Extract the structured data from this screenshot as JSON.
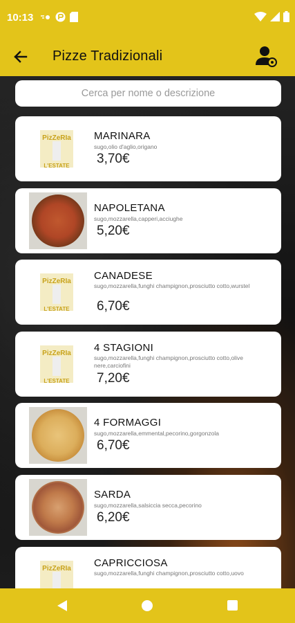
{
  "status": {
    "time": "10:13"
  },
  "header": {
    "title": "Pizze Tradizionali"
  },
  "search": {
    "placeholder": "Cerca per nome o descrizione"
  },
  "items": [
    {
      "name": "MARINARA",
      "desc": "sugo,olio d'aglio,origano",
      "price": "3,70€",
      "image": "logo"
    },
    {
      "name": "NAPOLETANA",
      "desc": "sugo,mozzarella,capperi,acciughe",
      "price": "5,20€",
      "image": "pizza"
    },
    {
      "name": "CANADESE",
      "desc": "sugo,mozzarella,funghi champignon,prosciutto cotto,wurstel",
      "price": "6,70€",
      "image": "logo"
    },
    {
      "name": "4 STAGIONI",
      "desc": "sugo,mozzarella,funghi champignon,prosciutto cotto,olive nere,carciofini",
      "price": "7,20€",
      "image": "logo"
    },
    {
      "name": "4 FORMAGGI",
      "desc": "sugo,mozzarella,emmental,pecorino,gorgonzola",
      "price": "6,70€",
      "image": "pizza"
    },
    {
      "name": "SARDA",
      "desc": "sugo,mozzarella,salsiccia secca,pecorino",
      "price": "6,20€",
      "image": "pizza"
    },
    {
      "name": "CAPRICCIOSA",
      "desc": "sugo,mozzarella,funghi champignon,prosciutto cotto,uovo",
      "price": "",
      "image": "logo"
    }
  ],
  "colors": {
    "accent": "#e3c41a"
  }
}
